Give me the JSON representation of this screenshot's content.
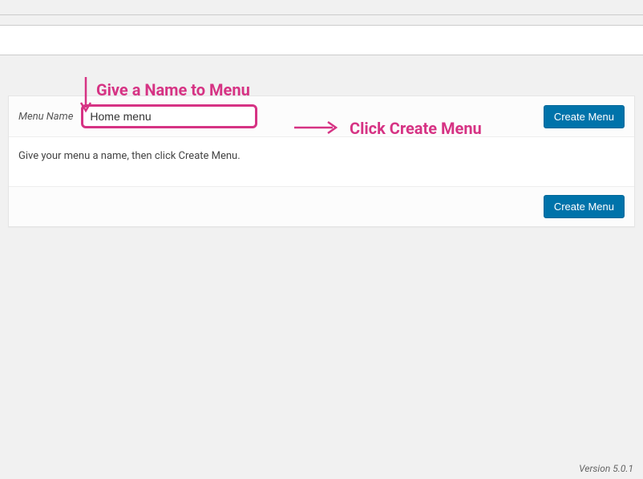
{
  "form": {
    "menu_name_label": "Menu Name",
    "menu_name_value": "Home menu",
    "create_button_label": "Create Menu",
    "instructions": "Give your menu a name, then click Create Menu."
  },
  "annotations": {
    "give_name": "Give a Name to Menu",
    "click_create": "Click Create Menu"
  },
  "footer": {
    "version": "Version 5.0.1"
  },
  "colors": {
    "accent_pink": "#d63384",
    "button_blue": "#0073aa"
  }
}
